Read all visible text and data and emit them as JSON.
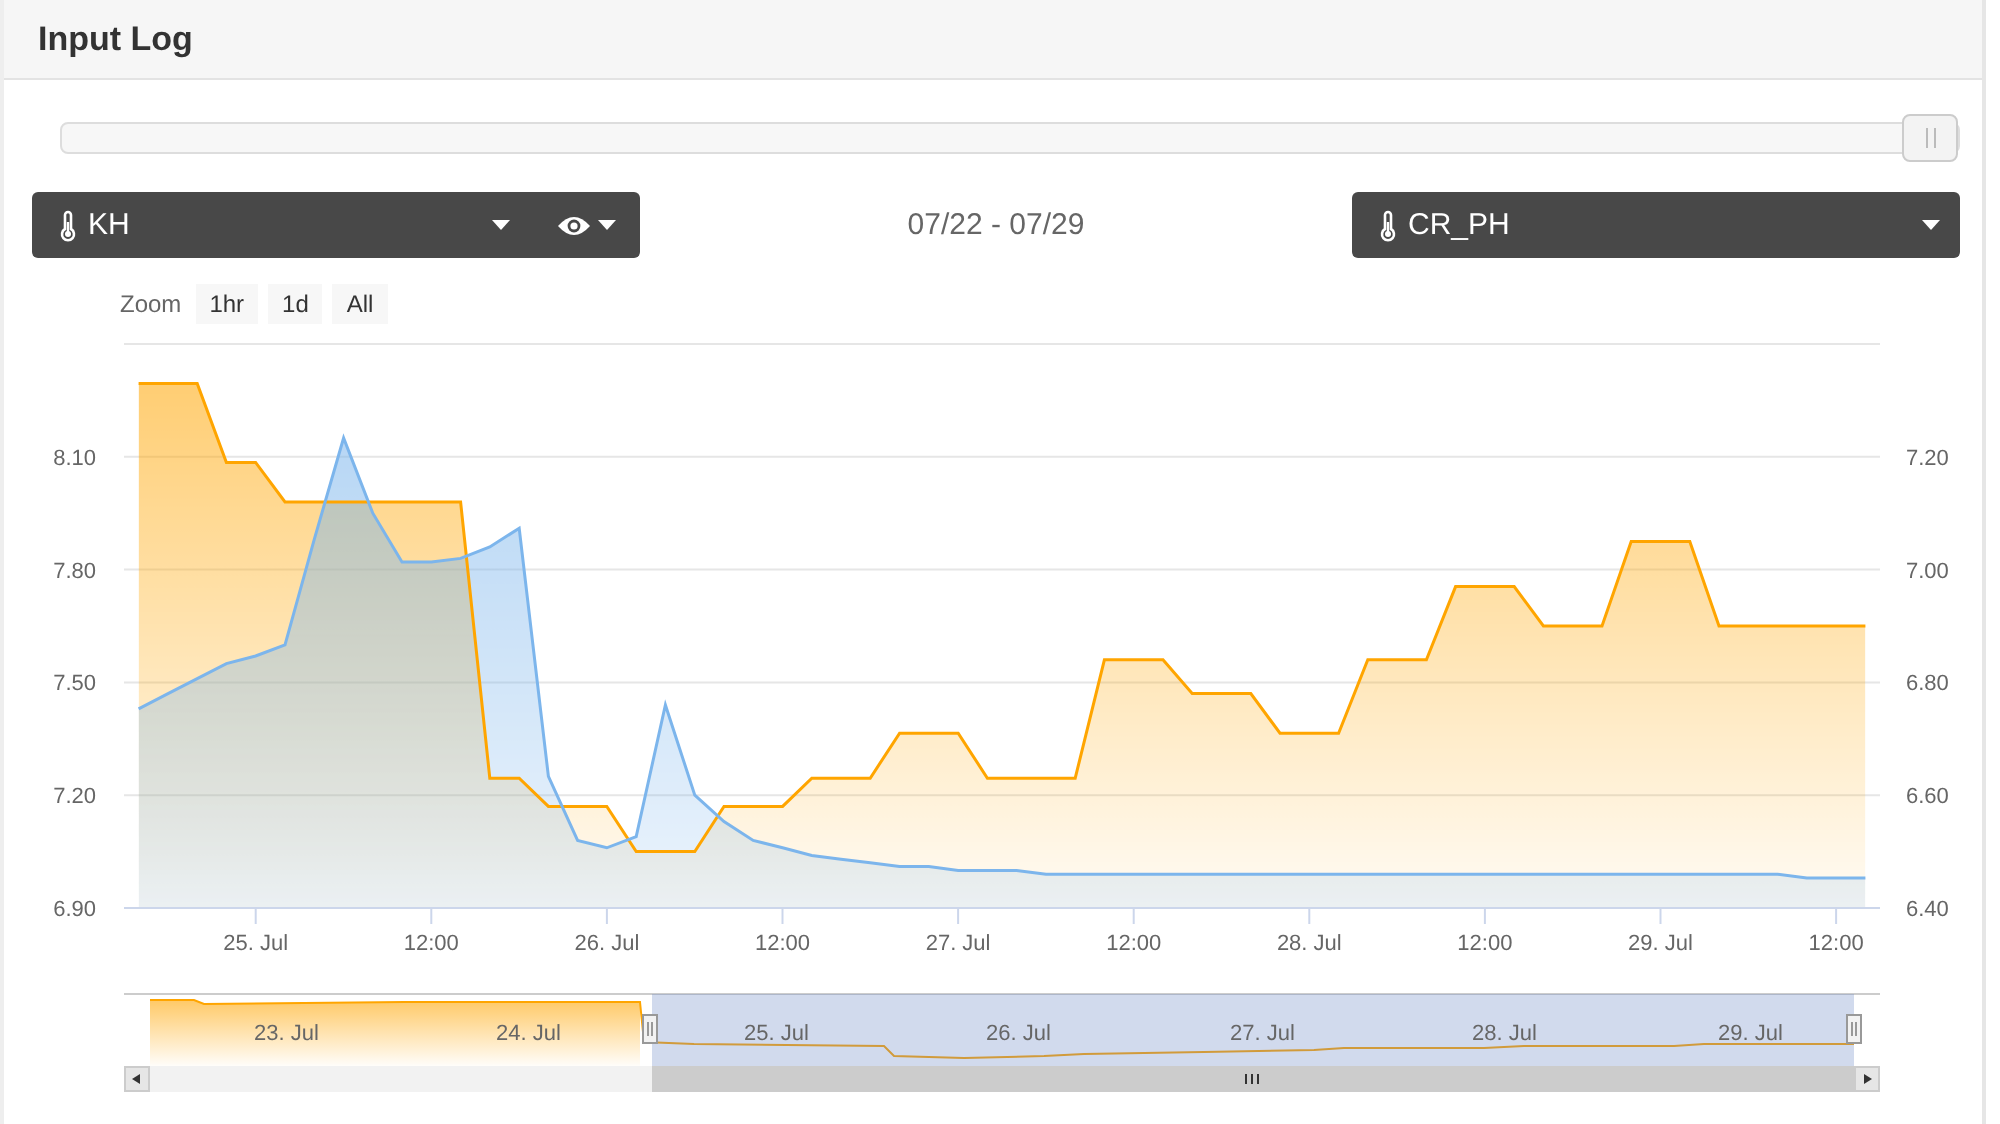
{
  "header": {
    "title": "Input Log"
  },
  "range_slider": {
    "level": 1
  },
  "left_select": {
    "label": "KH"
  },
  "date_range": "07/22 - 07/29",
  "right_select": {
    "label": "CR_PH"
  },
  "zoom": {
    "label": "Zoom",
    "buttons": [
      {
        "label": "1hr",
        "selected": false
      },
      {
        "label": "1d",
        "selected": false
      },
      {
        "label": "All",
        "selected": false
      }
    ]
  },
  "chart": {
    "chart_data": {
      "type": "area",
      "grid": true,
      "ylim": [
        6.9,
        8.4
      ],
      "y2lim": [
        6.4,
        7.4
      ],
      "categories": [
        null,
        null,
        null,
        null,
        "25. Jul",
        null,
        null,
        null,
        null,
        null,
        "12:00",
        null,
        null,
        null,
        null,
        null,
        "26. Jul",
        null,
        null,
        null,
        null,
        null,
        "12:00",
        null,
        null,
        null,
        null,
        null,
        "27. Jul",
        null,
        null,
        null,
        null,
        null,
        "12:00",
        null,
        null,
        null,
        null,
        null,
        "28. Jul",
        null,
        null,
        null,
        null,
        null,
        "12:00",
        null,
        null,
        null,
        null,
        null,
        "29. Jul",
        null,
        null,
        null,
        null,
        null,
        "12:00",
        null
      ],
      "yticks": [
        {
          "value": 6.9,
          "label": "6.90"
        },
        {
          "value": 7.2,
          "label": "7.20"
        },
        {
          "value": 7.5,
          "label": "7.50"
        },
        {
          "value": 7.8,
          "label": "7.80"
        },
        {
          "value": 8.1,
          "label": "8.10"
        }
      ],
      "y2ticks": [
        {
          "value": 6.4,
          "label": "6.40"
        },
        {
          "value": 6.6,
          "label": "6.60"
        },
        {
          "value": 6.8,
          "label": "6.80"
        },
        {
          "value": 7.0,
          "label": "7.00"
        },
        {
          "value": 7.2,
          "label": "7.20"
        }
      ],
      "series": [
        {
          "color": "#ffa500",
          "axis": "y2",
          "values": [
            7.33,
            7.33,
            7.33,
            7.19,
            7.19,
            7.12,
            7.12,
            7.12,
            7.12,
            7.12,
            7.12,
            7.12,
            6.63,
            6.63,
            6.58,
            6.58,
            6.58,
            6.5,
            6.5,
            6.5,
            6.58,
            6.58,
            6.58,
            6.63,
            6.63,
            6.63,
            6.71,
            6.71,
            6.71,
            6.63,
            6.63,
            6.63,
            6.63,
            6.84,
            6.84,
            6.84,
            6.78,
            6.78,
            6.78,
            6.71,
            6.71,
            6.71,
            6.84,
            6.84,
            6.84,
            6.97,
            6.97,
            6.97,
            6.9,
            6.9,
            6.9,
            7.05,
            7.05,
            7.05,
            6.9,
            6.9,
            6.9,
            6.9,
            6.9,
            6.9
          ]
        },
        {
          "color": "#7cb5ec",
          "values": [
            7.43,
            7.47,
            7.51,
            7.55,
            7.57,
            7.6,
            7.88,
            8.15,
            7.95,
            7.82,
            7.82,
            7.83,
            7.86,
            7.91,
            7.25,
            7.08,
            7.06,
            7.09,
            7.44,
            7.2,
            7.13,
            7.08,
            7.06,
            7.04,
            7.03,
            7.02,
            7.01,
            7.01,
            7.0,
            7.0,
            7.0,
            6.99,
            6.99,
            6.99,
            6.99,
            6.99,
            6.99,
            6.99,
            6.99,
            6.99,
            6.99,
            6.99,
            6.99,
            6.99,
            6.99,
            6.99,
            6.99,
            6.99,
            6.99,
            6.99,
            6.99,
            6.99,
            6.99,
            6.99,
            6.99,
            6.99,
            6.99,
            6.98,
            6.98,
            6.98
          ]
        }
      ]
    }
  },
  "navigator": {
    "labels": [
      "23. Jul",
      "24. Jul",
      "25. Jul",
      "26. Jul",
      "27. Jul",
      "28. Jul",
      "29. Jul"
    ]
  }
}
